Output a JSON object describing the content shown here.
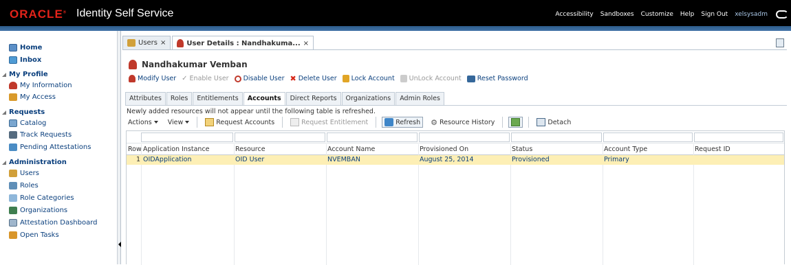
{
  "header": {
    "logo": "ORACLE",
    "title": "Identity Self Service",
    "links": [
      "Accessibility",
      "Sandboxes",
      "Customize",
      "Help",
      "Sign Out"
    ],
    "user": "xelsysadm"
  },
  "sidebar": {
    "home": "Home",
    "inbox": "Inbox",
    "my_profile": {
      "heading": "My Profile",
      "items": [
        "My Information",
        "My Access"
      ]
    },
    "requests": {
      "heading": "Requests",
      "items": [
        "Catalog",
        "Track Requests",
        "Pending Attestations"
      ]
    },
    "administration": {
      "heading": "Administration",
      "items": [
        "Users",
        "Roles",
        "Role Categories",
        "Organizations",
        "Attestation Dashboard",
        "Open Tasks"
      ]
    }
  },
  "doc_tabs": [
    {
      "label": "Users",
      "active": false
    },
    {
      "label": "User Details : Nandhakuma...",
      "active": true
    }
  ],
  "person": {
    "name": "Nandhakumar Vemban"
  },
  "actions": {
    "modify": "Modify User",
    "enable": "Enable User",
    "disable": "Disable User",
    "delete": "Delete User",
    "lock": "Lock Account",
    "unlock": "UnLock Account",
    "reset": "Reset Password"
  },
  "sub_tabs": [
    "Attributes",
    "Roles",
    "Entitlements",
    "Accounts",
    "Direct Reports",
    "Organizations",
    "Admin Roles"
  ],
  "active_sub_tab": "Accounts",
  "notice": "Newly added resources will not appear until the following table is refreshed.",
  "toolbar": {
    "actions": "Actions",
    "view": "View",
    "request_accounts": "Request Accounts",
    "request_entitlement": "Request Entitlement",
    "refresh": "Refresh",
    "resource_history": "Resource History",
    "detach": "Detach"
  },
  "table": {
    "columns": [
      "Row",
      "Application Instance",
      "Resource",
      "Account Name",
      "Provisioned On",
      "Status",
      "Account Type",
      "Request ID"
    ],
    "rows": [
      {
        "row": "1",
        "application_instance": "OIDApplication",
        "resource": "OID User",
        "account_name": "NVEMBAN",
        "provisioned_on": "August 25, 2014",
        "status": "Provisioned",
        "account_type": "Primary",
        "request_id": ""
      }
    ]
  },
  "colors": {
    "oracle_red": "#e2231a",
    "link_blue": "#0a3f7d",
    "selected_row": "#fdefb5",
    "header_black": "#000000"
  }
}
